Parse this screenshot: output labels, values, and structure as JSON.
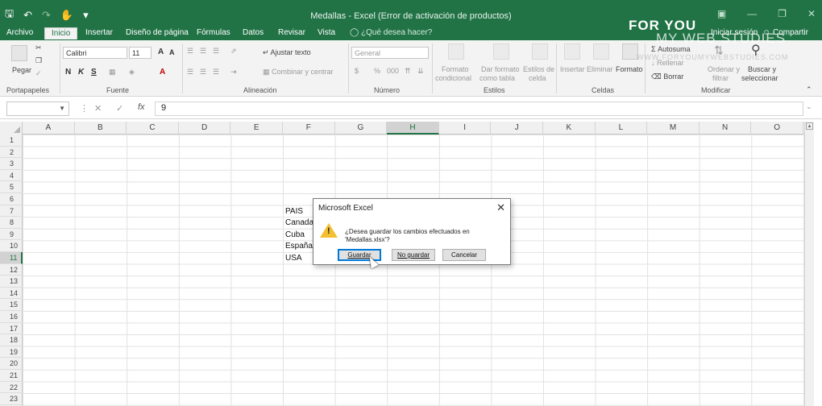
{
  "title_bar": {
    "title": "Medallas - Excel (Error de activación de productos)"
  },
  "tabs": [
    "Archivo",
    "Inicio",
    "Insertar",
    "Diseño de página",
    "Fórmulas",
    "Datos",
    "Revisar",
    "Vista"
  ],
  "active_tab": "Inicio",
  "tell_me": "¿Qué desea hacer?",
  "sign_in": "Iniciar sesión",
  "share": "Compartir",
  "watermark": {
    "line1": "FOR YOU",
    "line2": "MY WEB STUDIES",
    "line3": "WWW.FORYOUMYWEBSTUDIES.COM"
  },
  "ribbon": {
    "clipboard": {
      "paste": "Pegar",
      "group": "Portapapeles"
    },
    "font": {
      "name": "Calibri",
      "size": "11",
      "bold": "N",
      "italic": "K",
      "underline": "S",
      "group": "Fuente"
    },
    "alignment": {
      "wrap": "Ajustar texto",
      "merge": "Combinar y centrar",
      "group": "Alineación"
    },
    "number": {
      "format": "General",
      "currency": "$",
      "percent": "%",
      "thousands": "000",
      "group": "Número"
    },
    "styles": {
      "conditional1": "Formato",
      "conditional2": "condicional",
      "table1": "Dar formato",
      "table2": "como tabla",
      "cell1": "Estilos de",
      "cell2": "celda",
      "group": "Estilos"
    },
    "cells": {
      "insert": "Insertar",
      "delete": "Eliminar",
      "format": "Formato",
      "group": "Celdas"
    },
    "editing": {
      "autosum": "Autosuma",
      "fill": "Rellenar",
      "clear": "Borrar",
      "sort1": "Ordenar y",
      "sort2": "filtrar",
      "find1": "Buscar y",
      "find2": "seleccionar",
      "group": "Modificar"
    }
  },
  "formula_bar": {
    "name_box": "",
    "fx": "fx",
    "value": "9"
  },
  "columns": [
    "A",
    "B",
    "C",
    "D",
    "E",
    "F",
    "G",
    "H",
    "I",
    "J",
    "K",
    "L",
    "M",
    "N",
    "O"
  ],
  "selected_column": "H",
  "rows": [
    "1",
    "2",
    "3",
    "4",
    "5",
    "6",
    "7",
    "8",
    "9",
    "10",
    "11",
    "12",
    "13",
    "14",
    "15",
    "16",
    "17",
    "18",
    "19",
    "20",
    "21",
    "22",
    "23"
  ],
  "selected_row": "11",
  "cells": [
    {
      "ref": "F7",
      "value": "PAIS"
    },
    {
      "ref": "F8",
      "value": "Canada"
    },
    {
      "ref": "F9",
      "value": "Cuba"
    },
    {
      "ref": "F10",
      "value": "España"
    },
    {
      "ref": "F11",
      "value": "USA"
    }
  ],
  "dialog": {
    "title": "Microsoft Excel",
    "message_line1": "¿Desea guardar los cambios efectuados en",
    "message_line2": "'Medallas.xlsx'?",
    "buttons": {
      "save": "Guardar",
      "dont_save": "No guardar",
      "cancel": "Cancelar"
    }
  },
  "colors": {
    "excel_green": "#217346",
    "warning": "#f5c030"
  },
  "icons": [
    "save-icon",
    "undo-icon",
    "redo-icon",
    "touch-mode-icon",
    "customize-icon",
    "warning-icon",
    "close-icon",
    "lightbulb-icon",
    "user-icon"
  ]
}
